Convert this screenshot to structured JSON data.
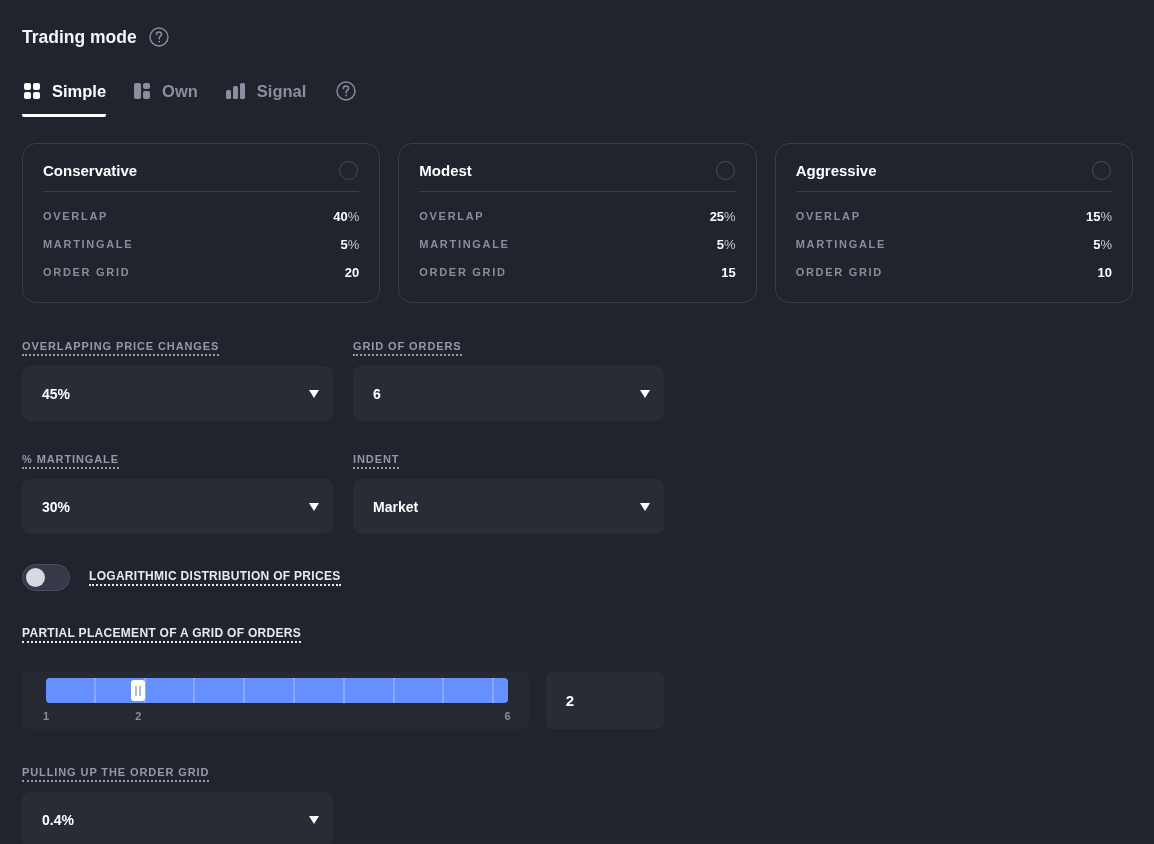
{
  "title": "Trading mode",
  "tabs": [
    {
      "label": "Simple",
      "selected": true
    },
    {
      "label": "Own",
      "selected": false
    },
    {
      "label": "Signal",
      "selected": false
    }
  ],
  "presets": [
    {
      "name": "Conservative",
      "selected": false,
      "stats": [
        {
          "label": "OVERLAP",
          "value": "40",
          "unit": "%"
        },
        {
          "label": "MARTINGALE",
          "value": "5",
          "unit": "%"
        },
        {
          "label": "ORDER GRID",
          "value": "20"
        }
      ]
    },
    {
      "name": "Modest",
      "selected": false,
      "stats": [
        {
          "label": "OVERLAP",
          "value": "25",
          "unit": "%"
        },
        {
          "label": "MARTINGALE",
          "value": "5",
          "unit": "%"
        },
        {
          "label": "ORDER GRID",
          "value": "15"
        }
      ]
    },
    {
      "name": "Aggressive",
      "selected": false,
      "stats": [
        {
          "label": "OVERLAP",
          "value": "15",
          "unit": "%"
        },
        {
          "label": "MARTINGALE",
          "value": "5",
          "unit": "%"
        },
        {
          "label": "ORDER GRID",
          "value": "10"
        }
      ]
    }
  ],
  "settings": [
    {
      "kind": "select",
      "label": "OVERLAPPING PRICE CHANGES",
      "value": "45%"
    },
    {
      "kind": "select",
      "label": "GRID OF ORDERS",
      "value": "6"
    },
    {
      "kind": "select",
      "label": "% MARTINGALE",
      "value": "30%"
    },
    {
      "kind": "select",
      "label": "INDENT",
      "value": "Market"
    },
    {
      "kind": "toggle",
      "label": "LOGARITHMIC DISTRIBUTION OF PRICES",
      "on": false
    },
    {
      "kind": "slider",
      "label": "PARTIAL PLACEMENT OF A GRID OF ORDERS",
      "level": 0.2,
      "min_label": "1",
      "value_label": "2",
      "max_label": "6",
      "value": "2"
    },
    {
      "kind": "select",
      "label": "PULLING UP THE ORDER GRID",
      "value": "0.4%"
    }
  ]
}
